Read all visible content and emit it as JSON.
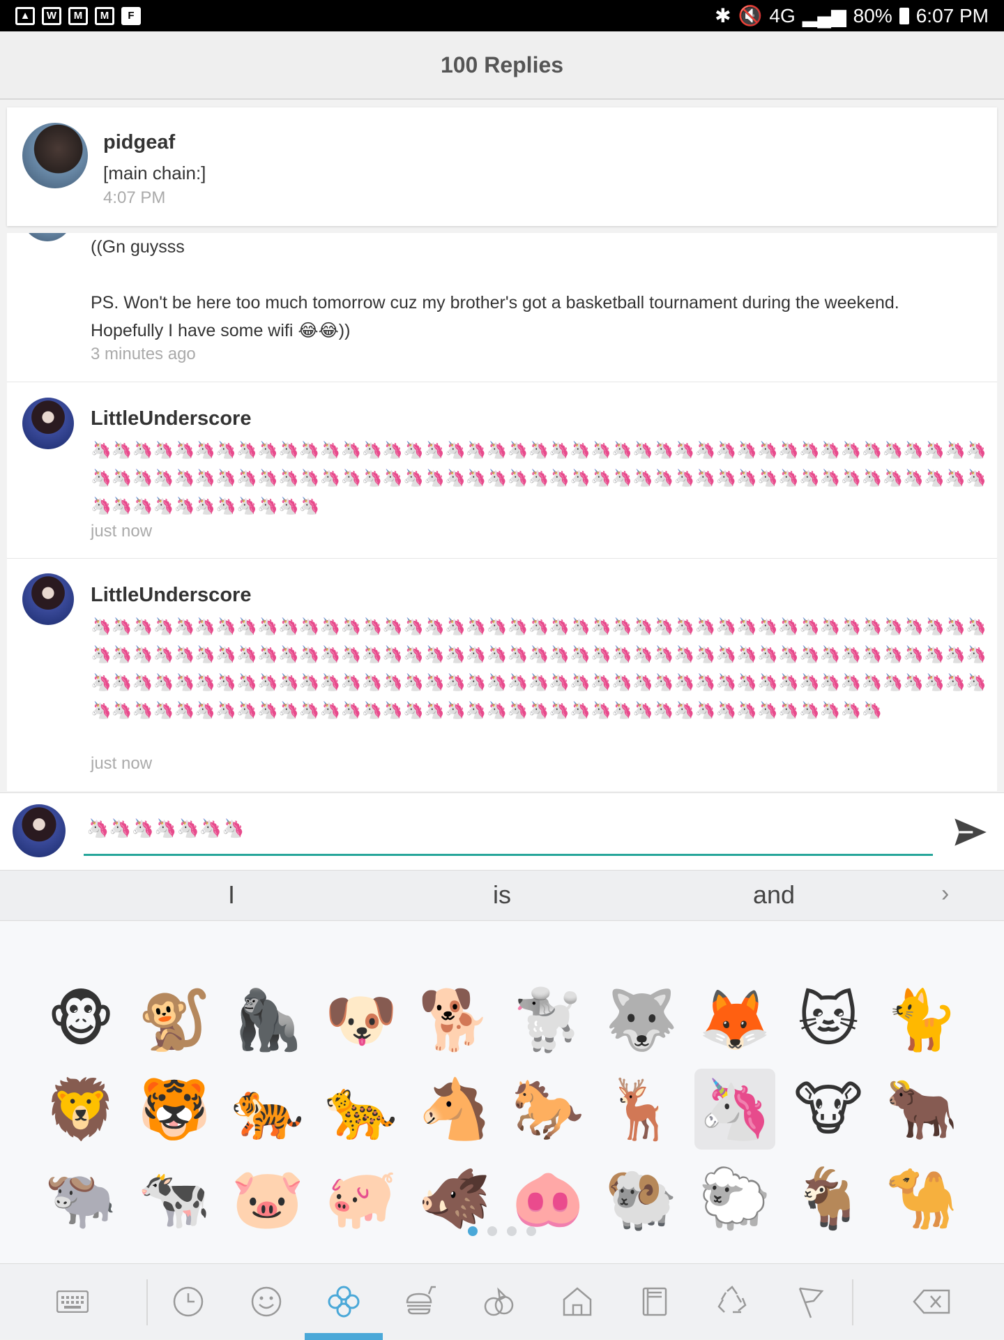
{
  "status_bar": {
    "right_text": "4G · 80%",
    "battery": "80%",
    "time": "6:07 PM",
    "network": "4G",
    "left_icons": [
      "image-icon",
      "w-icon",
      "mail-outline-icon",
      "mail-icon",
      "flipboard-icon"
    ]
  },
  "header": {
    "title": "100 Replies"
  },
  "pinned": {
    "username": "pidgeaf",
    "text": "[main chain:]",
    "time": "4:07 PM"
  },
  "messages": [
    {
      "line1": "((Gn guysss",
      "line2": "PS. Won't be here too much tomorrow cuz my brother's got a basketball tournament during the weekend.",
      "line3": "Hopefully I have some wifi 😂😂))",
      "time": "3 minutes ago"
    },
    {
      "username": "LittleUnderscore",
      "unicorn_count": 97,
      "time": "just now"
    },
    {
      "username": "LittleUnderscore",
      "unicorn_count": 167,
      "time": "just now"
    }
  ],
  "composer": {
    "value": "🦄🦄🦄🦄🦄🦄🦄",
    "send_icon": "send-icon"
  },
  "suggestions": [
    "I",
    "is",
    "and"
  ],
  "emoji_grid": [
    [
      "🐵",
      "🐒",
      "🦍",
      "🐶",
      "🐕",
      "🐩",
      "🐺",
      "🦊",
      "🐱",
      "🐈"
    ],
    [
      "🦁",
      "🐯",
      "🐅",
      "🐆",
      "🐴",
      "🐎",
      "🦌",
      "🦄",
      "🐮",
      "🐂"
    ],
    [
      "🐃",
      "🐄",
      "🐷",
      "🐖",
      "🐗",
      "🐽",
      "🐏",
      "🐑",
      "🐐",
      "🐪"
    ]
  ],
  "selected_emoji": "🦄",
  "page_dots": {
    "count": 4,
    "active": 1
  },
  "keyboard_tabs": [
    "keyboard-icon",
    "recent-clock-icon",
    "smiley-icon",
    "clover-icon",
    "food-icon",
    "sports-icon",
    "house-icon",
    "objects-icon",
    "recycle-icon",
    "flag-icon",
    "backspace-icon"
  ],
  "colors": {
    "accent": "#26a69a",
    "tab_active": "#4aa8d8"
  }
}
